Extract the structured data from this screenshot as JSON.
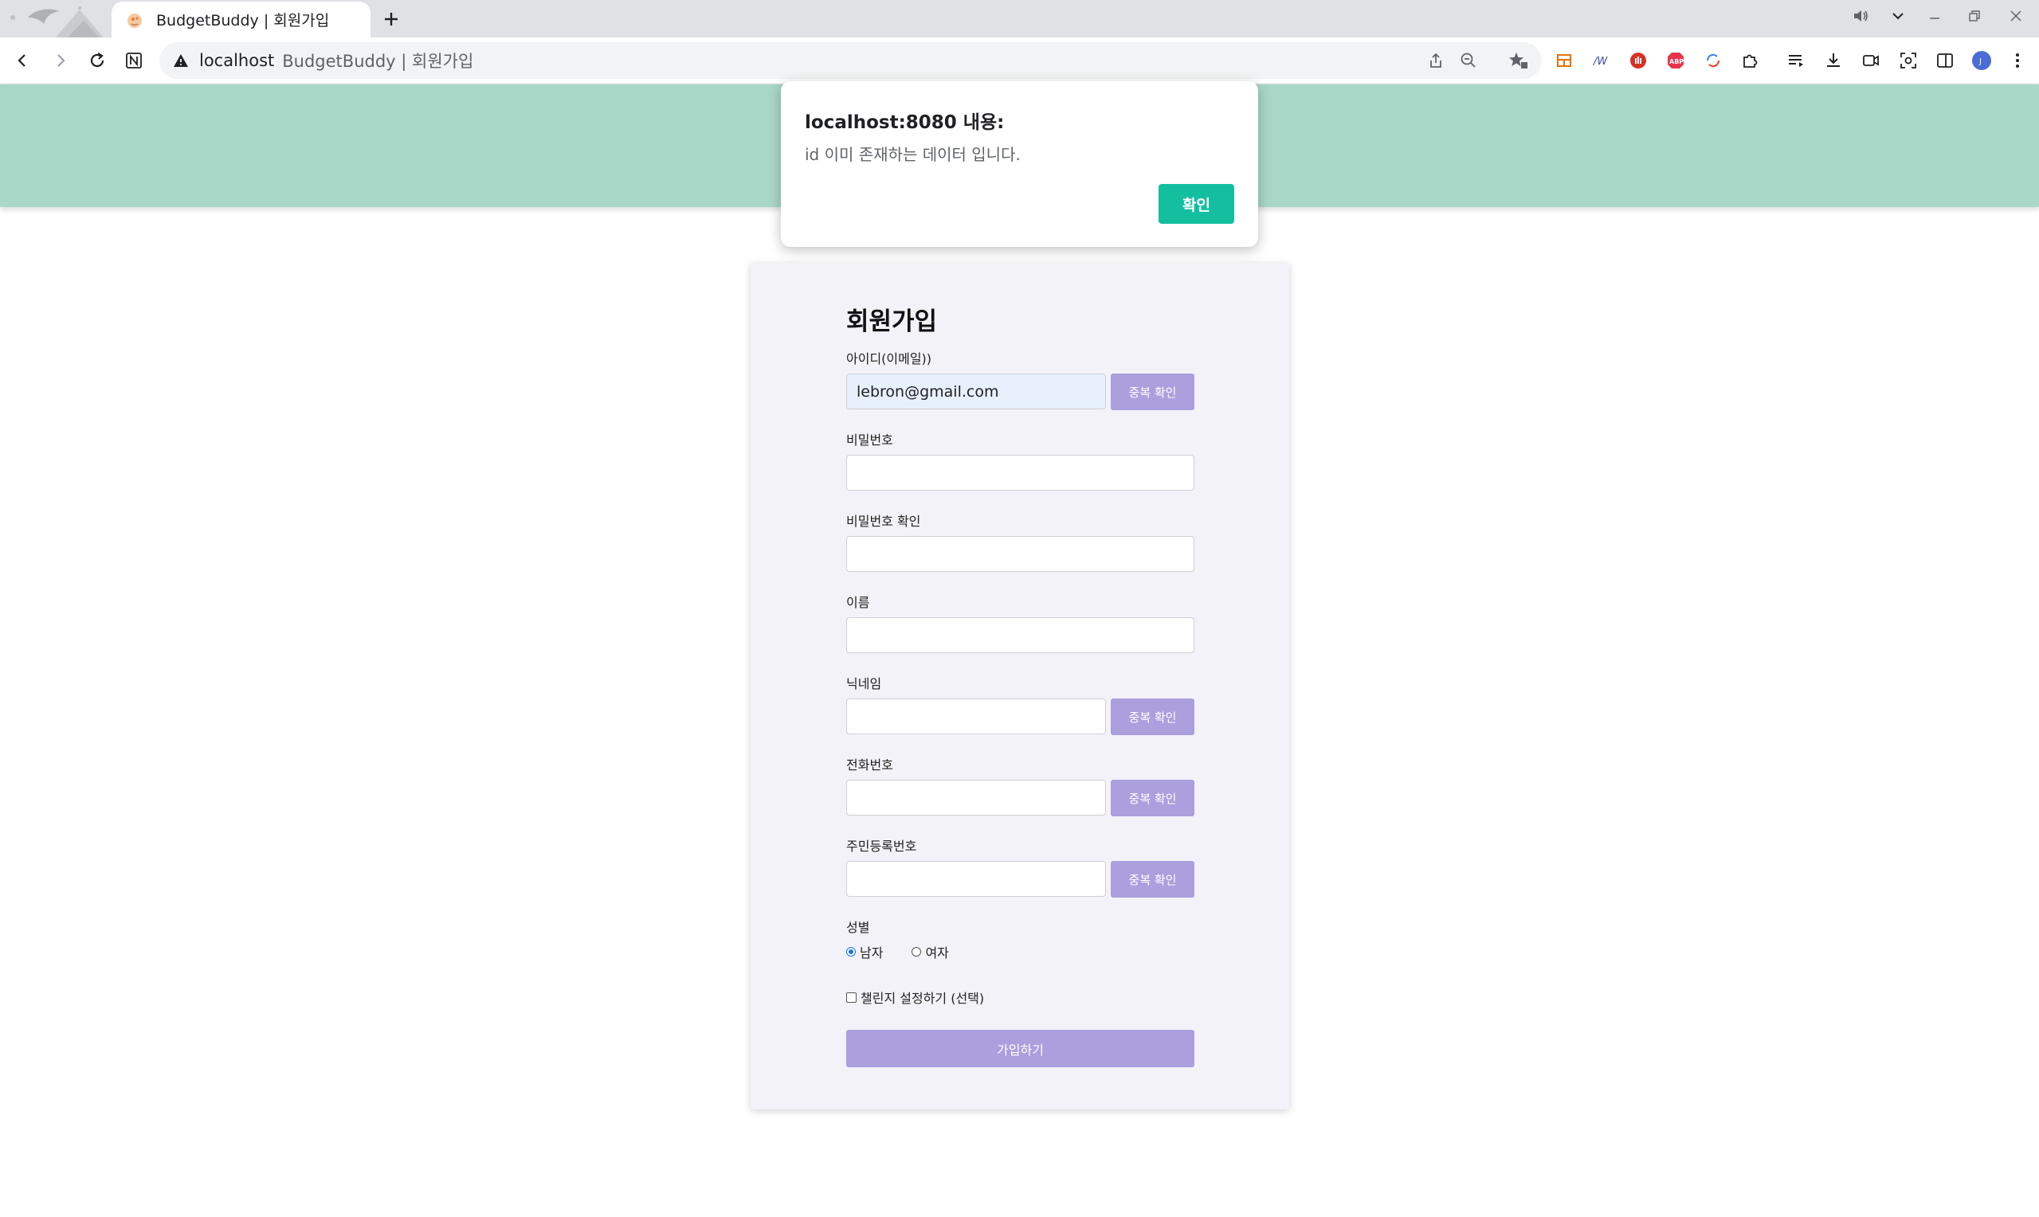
{
  "browser": {
    "tab_title": "BudgetBuddy | 회원가입",
    "address_host": "localhost",
    "address_title": "BudgetBuddy | 회원가입"
  },
  "colors": {
    "header_bg": "#a9d7c8",
    "card_bg": "#f3f2f8",
    "button_purple": "#ab9fde",
    "alert_ok": "#14bfa0"
  },
  "alert": {
    "title": "localhost:8080 내용:",
    "message": "id 이미 존재하는 데이터 입니다.",
    "ok_label": "확인"
  },
  "form": {
    "title": "회원가입",
    "id_label": "아이디(이메일))",
    "id_value": "lebron@gmail.com",
    "check_label": "중복 확인",
    "password_label": "비밀번호",
    "password_confirm_label": "비밀번호 확인",
    "name_label": "이름",
    "nickname_label": "닉네임",
    "phone_label": "전화번호",
    "rrn_label": "주민등록번호",
    "gender_label": "성별",
    "gender_options": [
      "남자",
      "여자"
    ],
    "gender_selected": "남자",
    "challenge_label": "챌린지 설정하기 (선택)",
    "challenge_checked": false,
    "submit_label": "가입하기"
  }
}
